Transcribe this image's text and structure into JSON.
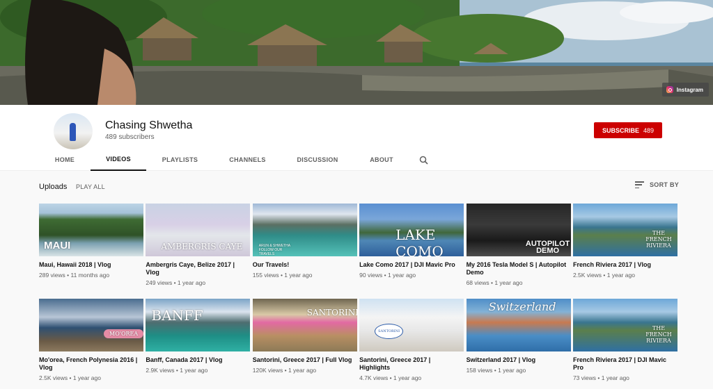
{
  "banner": {
    "link_label": "Instagram"
  },
  "channel": {
    "name": "Chasing Shwetha",
    "subscribers": "489 subscribers",
    "subscribe_label": "SUBSCRIBE",
    "subscribe_count": "489"
  },
  "tabs": [
    {
      "label": "HOME",
      "active": false
    },
    {
      "label": "VIDEOS",
      "active": true
    },
    {
      "label": "PLAYLISTS",
      "active": false
    },
    {
      "label": "CHANNELS",
      "active": false
    },
    {
      "label": "DISCUSSION",
      "active": false
    },
    {
      "label": "ABOUT",
      "active": false
    }
  ],
  "uploads": {
    "title": "Uploads",
    "play_all": "PLAY ALL",
    "sort_by": "SORT BY"
  },
  "videos": [
    {
      "thumb_text": "MAUI",
      "title": "Maui, Hawaii 2018 | Vlog",
      "views": "289 views",
      "age": "11 months ago"
    },
    {
      "thumb_text": "AMBERGRIS CAYE",
      "title": "Ambergris Caye, Belize 2017 | Vlog",
      "views": "249 views",
      "age": "1 year ago"
    },
    {
      "thumb_text": "ARUN & SHWETHA FOLLOW OUR TRAVELS",
      "title": "Our Travels!",
      "views": "155 views",
      "age": "1 year ago"
    },
    {
      "thumb_text": "LAKE COMO",
      "title": "Lake Como 2017 | DJI Mavic Pro",
      "views": "90 views",
      "age": "1 year ago"
    },
    {
      "thumb_text": "AUTOPILOT DEMO",
      "title": "My 2016 Tesla Model S | Autopilot Demo",
      "views": "68 views",
      "age": "1 year ago"
    },
    {
      "thumb_text": "THE FRENCH RIVIERA",
      "title": "French Riviera 2017 | Vlog",
      "views": "2.5K views",
      "age": "1 year ago"
    },
    {
      "thumb_text": "MO'OREA",
      "title": "Mo'orea, French Polynesia 2016 | Vlog",
      "views": "2.5K views",
      "age": "1 year ago"
    },
    {
      "thumb_text": "BANFF",
      "title": "Banff, Canada 2017 | Vlog",
      "views": "2.9K views",
      "age": "1 year ago"
    },
    {
      "thumb_text": "SANTORINI",
      "title": "Santorini, Greece 2017 | Full Vlog",
      "views": "120K views",
      "age": "1 year ago"
    },
    {
      "thumb_text": "SANTORINI",
      "title": "Santorini, Greece 2017 | Highlights",
      "views": "4.7K views",
      "age": "1 year ago"
    },
    {
      "thumb_text": "Switzerland",
      "title": "Switzerland 2017 | Vlog",
      "views": "158 views",
      "age": "1 year ago"
    },
    {
      "thumb_text": "THE FRENCH RIVIERA",
      "title": "French Riviera 2017 | DJI Mavic Pro",
      "views": "73 views",
      "age": "1 year ago"
    }
  ],
  "colors": {
    "subscribe_red": "#cc0000",
    "text_secondary": "#606060",
    "background": "#f9f9f9"
  }
}
